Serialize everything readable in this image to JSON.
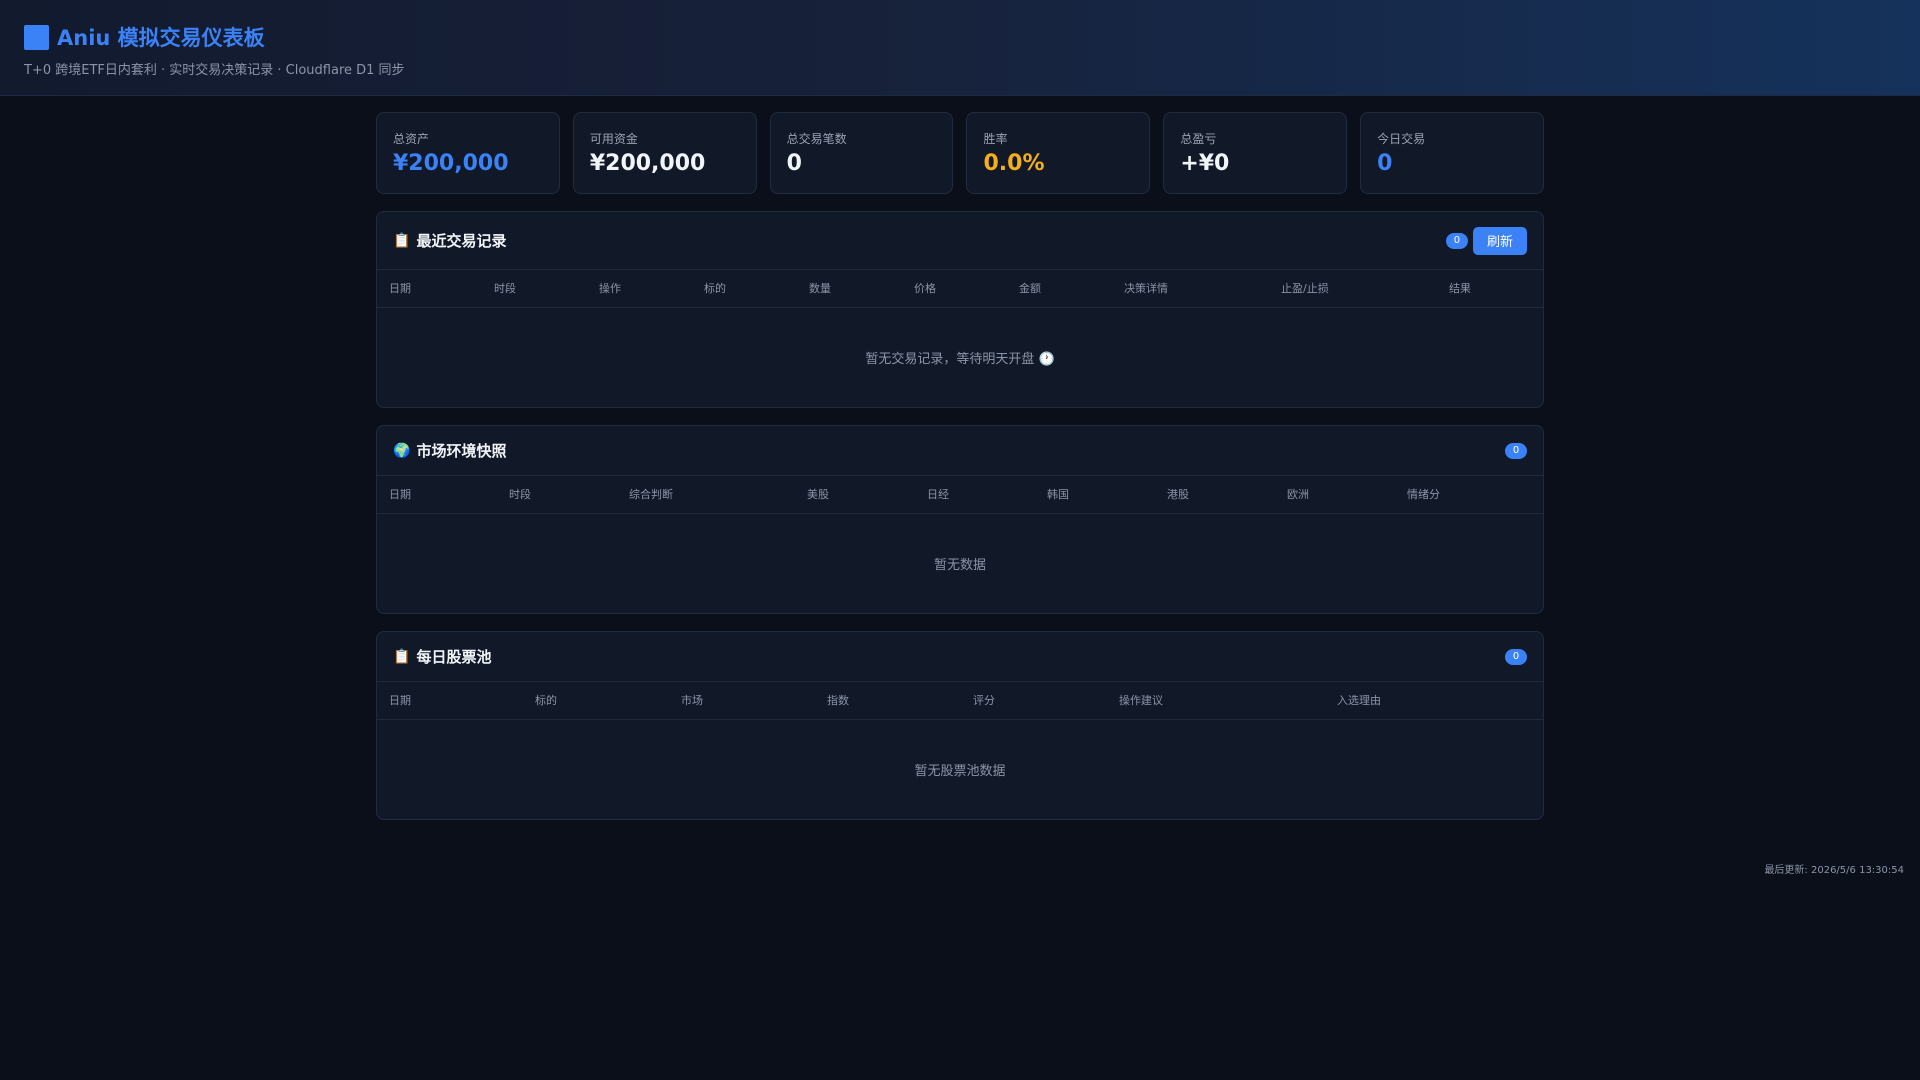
{
  "header": {
    "title": "Aniu 模拟交易仪表板",
    "subtitle": "T+0 跨境ETF日内套利 · 实时交易决策记录 · Cloudflare D1 同步"
  },
  "stats": [
    {
      "label": "总资产",
      "value": "¥200,000",
      "color": "#3b82f6"
    },
    {
      "label": "可用资金",
      "value": "¥200,000",
      "color": "#f1f5f9"
    },
    {
      "label": "总交易笔数",
      "value": "0",
      "color": "#f1f5f9"
    },
    {
      "label": "胜率",
      "value": "0.0%",
      "color": "#f5b019"
    },
    {
      "label": "总盈亏",
      "value": "+¥0",
      "color": "#f1f5f9"
    },
    {
      "label": "今日交易",
      "value": "0",
      "color": "#3b82f6"
    }
  ],
  "trades": {
    "icon": "clipboard-icon",
    "title": "最近交易记录",
    "count": "0",
    "refresh_label": "刷新",
    "columns": [
      "日期",
      "时段",
      "操作",
      "标的",
      "数量",
      "价格",
      "金额",
      "决策详情",
      "止盈/止损",
      "结果"
    ],
    "empty": "暂无交易记录，等待明天开盘 🕐"
  },
  "market": {
    "icon": "globe-icon",
    "title": "市场环境快照",
    "count": "0",
    "columns": [
      "日期",
      "时段",
      "综合判断",
      "美股",
      "日经",
      "韩国",
      "港股",
      "欧洲",
      "情绪分"
    ],
    "empty": "暂无数据"
  },
  "pool": {
    "icon": "clipboard-icon",
    "title": "每日股票池",
    "count": "0",
    "columns": [
      "日期",
      "标的",
      "市场",
      "指数",
      "评分",
      "操作建议",
      "入选理由"
    ],
    "empty": "暂无股票池数据"
  },
  "footer": {
    "last_updated": "最后更新: 2026/5/6 13:30:54"
  }
}
